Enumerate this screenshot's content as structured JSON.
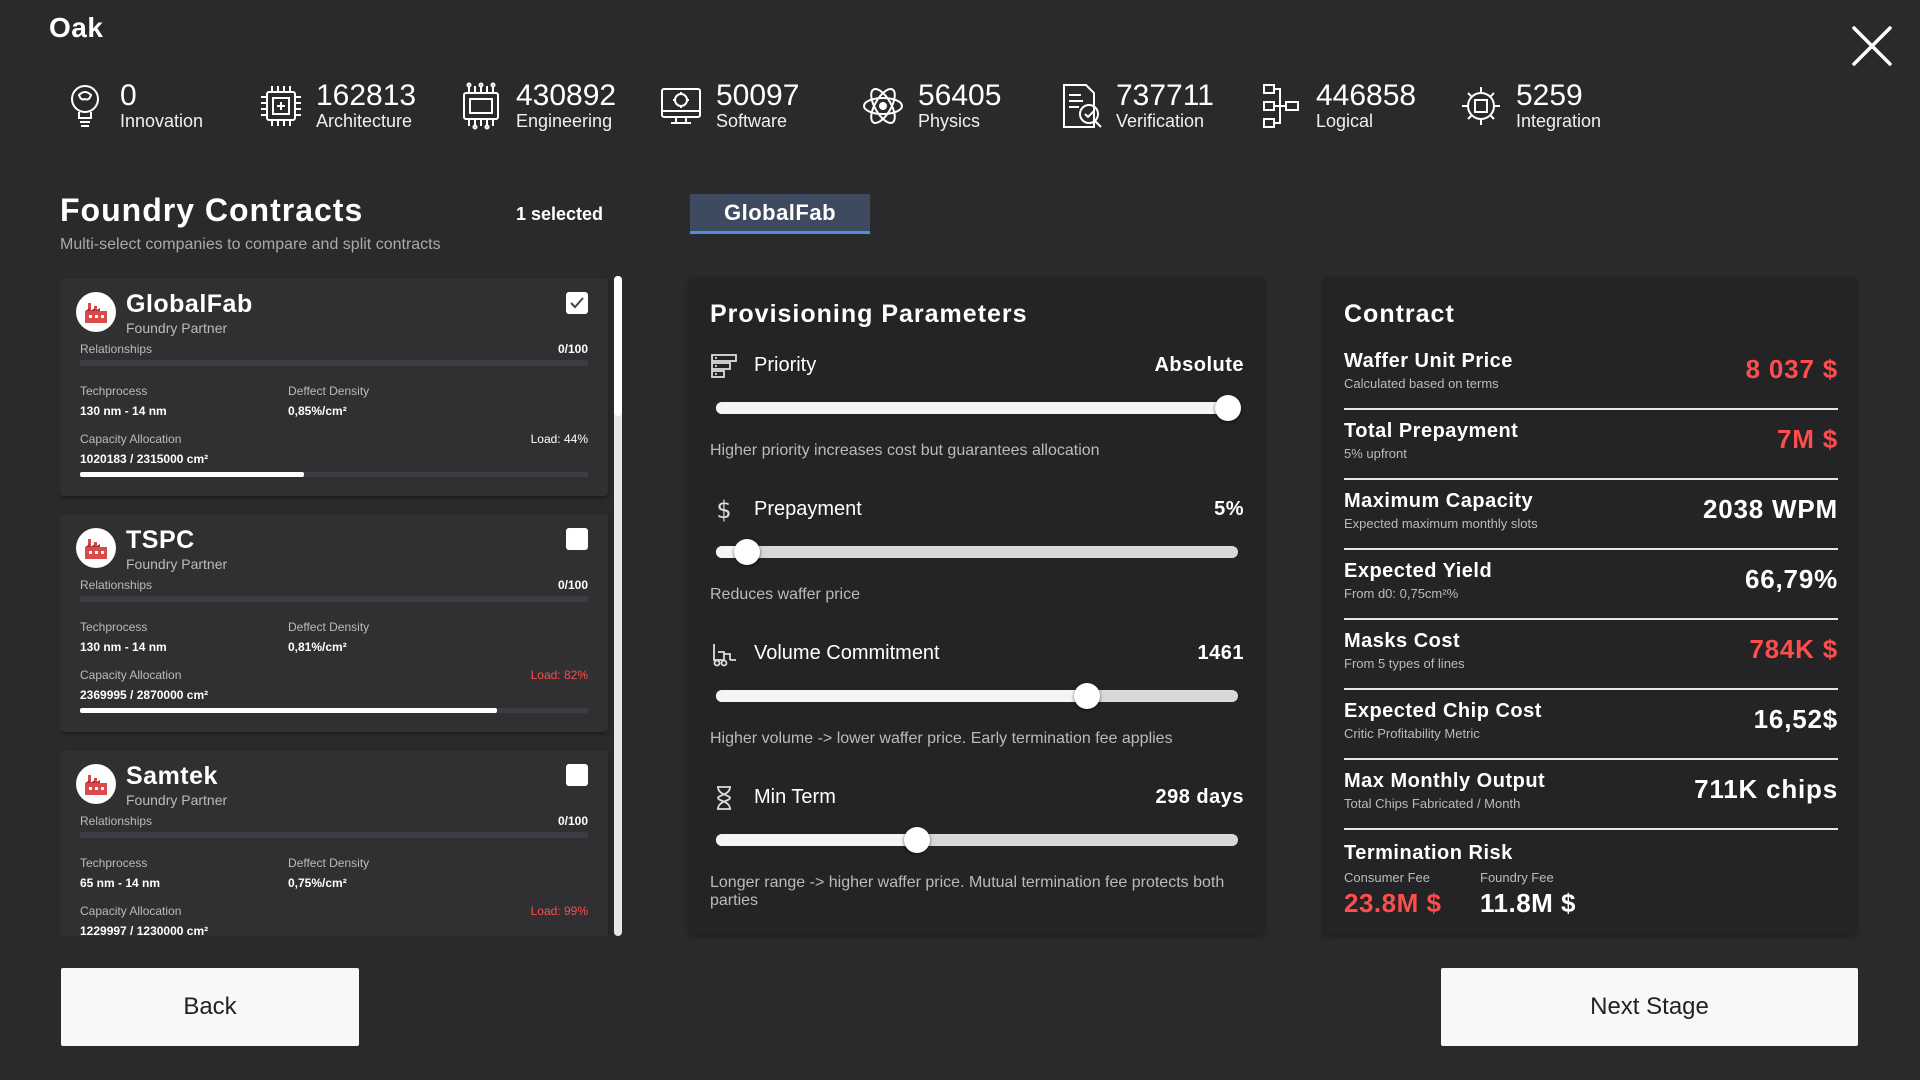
{
  "header": {
    "company": "Oak",
    "close_icon": "close-icon"
  },
  "stats": [
    {
      "value": "0",
      "label": "Innovation",
      "icon": "lightbulb-brain-icon"
    },
    {
      "value": "162813",
      "label": "Architecture",
      "icon": "chip-circuit-icon"
    },
    {
      "value": "430892",
      "label": "Engineering",
      "icon": "processor-icon"
    },
    {
      "value": "50097",
      "label": "Software",
      "icon": "computer-code-icon"
    },
    {
      "value": "56405",
      "label": "Physics",
      "icon": "atom-icon"
    },
    {
      "value": "737711",
      "label": "Verification",
      "icon": "document-check-icon"
    },
    {
      "value": "446858",
      "label": "Logical",
      "icon": "logic-flow-icon"
    },
    {
      "value": "5259",
      "label": "Integration",
      "icon": "gear-chip-icon"
    }
  ],
  "foundry": {
    "title": "Foundry Contracts",
    "subtitle": "Multi-select companies to compare and split contracts",
    "selected": "1 selected",
    "companies": [
      {
        "name": "GlobalFab",
        "role": "Foundry Partner",
        "checked": true,
        "relationships_label": "Relationships",
        "relationships": "0/100",
        "techprocess_label": "Techprocess",
        "techprocess": "130 nm - 14 nm",
        "density_label": "Deffect Density",
        "density": "0,85%/cm²",
        "capacity_label": "Capacity Allocation",
        "capacity": "1020183 / 2315000 cm²",
        "load": "Load: 44%",
        "load_fraction": 0.44,
        "load_color": "#ffffff"
      },
      {
        "name": "TSPC",
        "role": "Foundry Partner",
        "checked": false,
        "relationships_label": "Relationships",
        "relationships": "0/100",
        "techprocess_label": "Techprocess",
        "techprocess": "130 nm - 14 nm",
        "density_label": "Deffect Density",
        "density": "0,81%/cm²",
        "capacity_label": "Capacity Allocation",
        "capacity": "2369995 / 2870000 cm²",
        "load": "Load: 82%",
        "load_fraction": 0.82,
        "load_color": "#ff4c4c"
      },
      {
        "name": "Samtek",
        "role": "Foundry Partner",
        "checked": false,
        "relationships_label": "Relationships",
        "relationships": "0/100",
        "techprocess_label": "Techprocess",
        "techprocess": "65 nm - 14 nm",
        "density_label": "Deffect Density",
        "density": "0,75%/cm²",
        "capacity_label": "Capacity Allocation",
        "capacity": "1229997 / 1230000 cm²",
        "load": "Load: 99%",
        "load_fraction": 0.99,
        "load_color": "#ff4c4c"
      }
    ]
  },
  "tab": {
    "label": "GlobalFab"
  },
  "provisioning": {
    "title": "Provisioning Parameters",
    "params": [
      {
        "name": "Priority",
        "value": "Absolute",
        "icon": "priority-list-icon",
        "fraction": 0.98,
        "desc": "Higher priority increases cost but guarantees allocation"
      },
      {
        "name": "Prepayment",
        "value": "5%",
        "icon": "dollar-icon",
        "fraction": 0.06,
        "desc": "Reduces waffer price"
      },
      {
        "name": "Volume Commitment",
        "value": "1461",
        "icon": "forklift-icon",
        "fraction": 0.71,
        "desc": "Higher volume -> lower waffer price. Early termination fee applies"
      },
      {
        "name": "Min Term",
        "value": "298 days",
        "icon": "hourglass-icon",
        "fraction": 0.385,
        "desc": "Longer range -> higher waffer price.  Mutual termination fee protects both parties"
      }
    ]
  },
  "contract": {
    "title": "Contract",
    "rows": [
      {
        "title": "Waffer Unit Price",
        "sub": "Calculated based on terms",
        "value": "8 037 $",
        "red": true
      },
      {
        "title": "Total Prepayment",
        "sub": "5% upfront",
        "value": "7M $",
        "red": true
      },
      {
        "title": "Maximum Capacity",
        "sub": "Expected maximum monthly slots",
        "value": "2038 WPM",
        "red": false
      },
      {
        "title": "Expected Yield",
        "sub": "From d0: 0,75cm²%",
        "value": "66,79%",
        "red": false
      },
      {
        "title": "Masks Cost",
        "sub": "From 5 types of lines",
        "value": "784K $",
        "red": true
      },
      {
        "title": "Expected Chip Cost",
        "sub": "Critic Profitability Metric",
        "value": "16,52$",
        "red": false
      },
      {
        "title": "Max Monthly Output",
        "sub": "Total Chips Fabricated / Month",
        "value": "711K chips",
        "red": false
      }
    ],
    "termination": {
      "title": "Termination Risk",
      "consumer_label": "Consumer Fee",
      "consumer_value": "23.8M $",
      "foundry_label": "Foundry Fee",
      "foundry_value": "11.8M $"
    }
  },
  "buttons": {
    "back": "Back",
    "next": "Next Stage"
  }
}
